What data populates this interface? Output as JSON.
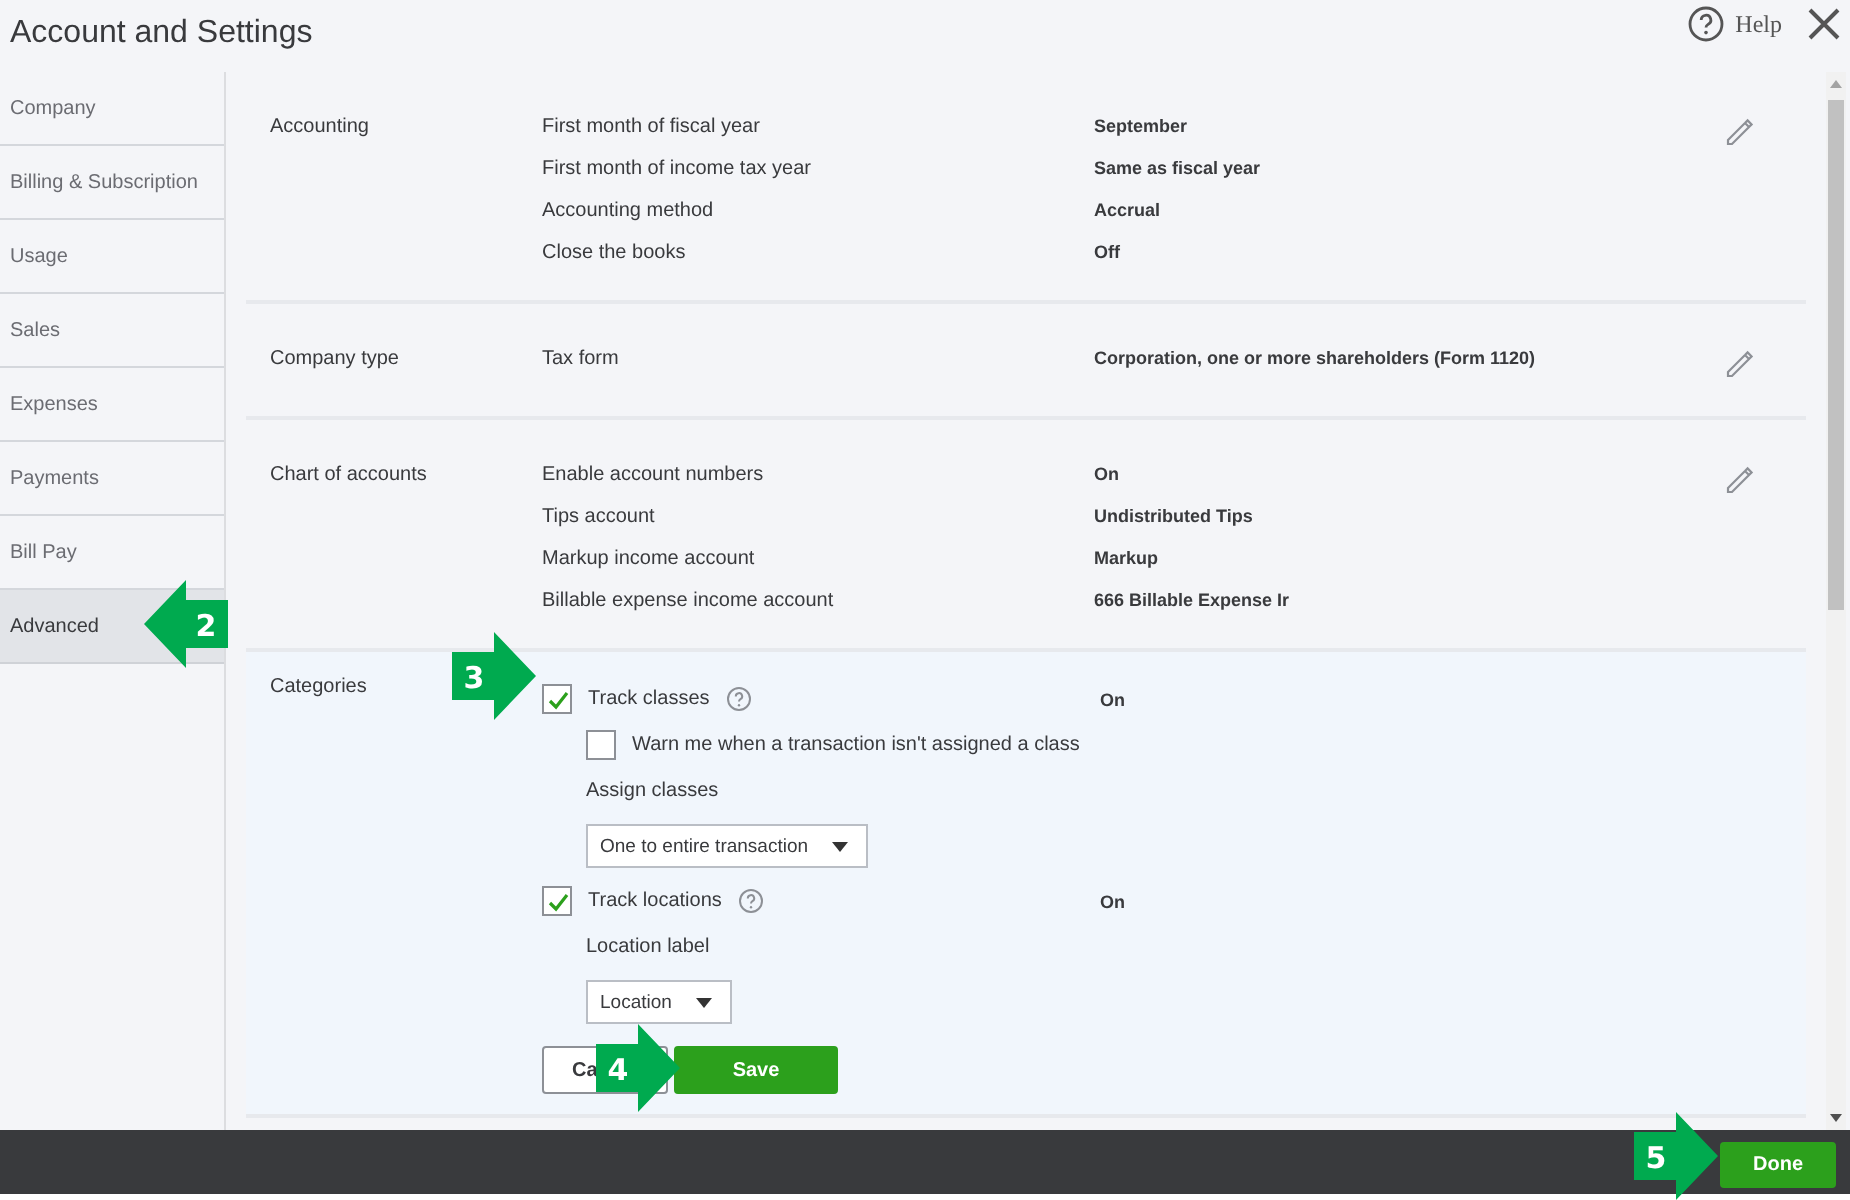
{
  "window": {
    "title": "Account and Settings",
    "help": "Help"
  },
  "sidebar": {
    "items": [
      {
        "label": "Company",
        "selected": false
      },
      {
        "label": "Billing & Subscription",
        "selected": false
      },
      {
        "label": "Usage",
        "selected": false
      },
      {
        "label": "Sales",
        "selected": false
      },
      {
        "label": "Expenses",
        "selected": false
      },
      {
        "label": "Payments",
        "selected": false
      },
      {
        "label": "Bill Pay",
        "selected": false
      },
      {
        "label": "Advanced",
        "selected": true
      }
    ]
  },
  "sections": [
    {
      "kind": "summary",
      "title": "Accounting",
      "editing": false,
      "rows": [
        {
          "label": "First month of fiscal year",
          "value": "September"
        },
        {
          "label": "First month of income tax year",
          "value": "Same as fiscal year"
        },
        {
          "label": "Accounting method",
          "value": "Accrual"
        },
        {
          "label": "Close the books",
          "value": "Off"
        }
      ]
    },
    {
      "kind": "summary",
      "title": "Company type",
      "editing": false,
      "rows": [
        {
          "label": "Tax form",
          "value": "Corporation, one or more shareholders (Form 1120)"
        }
      ]
    },
    {
      "kind": "summary",
      "title": "Chart of accounts",
      "editing": false,
      "rows": [
        {
          "label": "Enable account numbers",
          "value": "On"
        },
        {
          "label": "Tips account",
          "value": "Undistributed Tips"
        },
        {
          "label": "Markup income account",
          "value": "Markup"
        },
        {
          "label": "Billable expense income account",
          "value": "666 Billable Expense Ir"
        }
      ]
    },
    {
      "kind": "form",
      "title": "Categories",
      "editing": true,
      "controls": [
        {
          "kind": "checkbox",
          "label": "Track classes",
          "checked": true,
          "help": true,
          "value": "On",
          "children": [
            {
              "kind": "checkbox",
              "label": "Warn me when a transaction isn't assigned a class",
              "checked": false,
              "help": false
            },
            {
              "kind": "label",
              "text": "Assign classes"
            },
            {
              "kind": "dropdown",
              "value": "One to entire transaction"
            }
          ]
        },
        {
          "kind": "checkbox",
          "label": "Track locations",
          "checked": true,
          "help": true,
          "value": "On",
          "children": [
            {
              "kind": "label",
              "text": "Location label"
            },
            {
              "kind": "dropdown",
              "value": "Location"
            }
          ]
        }
      ],
      "buttons": [
        {
          "kind": "secondary",
          "label": "Ca"
        },
        {
          "kind": "primary",
          "label": "Save"
        }
      ]
    }
  ],
  "footer": {
    "button": "Done"
  },
  "callouts": [
    {
      "label": "2",
      "kind": "left"
    },
    {
      "label": "3",
      "kind": "right"
    },
    {
      "label": "4",
      "kind": "right"
    },
    {
      "label": "5",
      "kind": "right"
    }
  ]
}
